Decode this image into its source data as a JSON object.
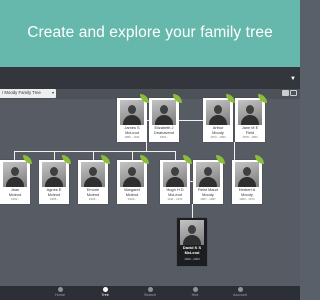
{
  "promo": {
    "title": "Create and explore your family tree"
  },
  "toolbar": {
    "tree_name": "/ Moody Family Tree"
  },
  "cards": [
    {
      "name": "James S\nMcLeod",
      "dates": "1856 - 1911"
    },
    {
      "name": "Elizabeth J\nDeahavend",
      "dates": "1864 -"
    },
    {
      "name": "Arthur\nMoody",
      "dates": "1872 - 1950"
    },
    {
      "name": "Jane M E\nField",
      "dates": "1878 - 1950"
    },
    {
      "name": "Jean\nMcleod",
      "dates": "1900 -"
    },
    {
      "name": "Agnes E\nMcleod",
      "dates": "1905 -"
    },
    {
      "name": "Emorie\nMcleod",
      "dates": "1906 -"
    },
    {
      "name": "Margaret\nMcleod",
      "dates": "1909 -"
    },
    {
      "name": "Hugh H D\nMcLeod",
      "dates": "1911 - 1971"
    },
    {
      "name": "Reist Maud\nMoody",
      "dates": "1907 - 1997"
    },
    {
      "name": "Herbert A\nMoody",
      "dates": "1906 - 1970"
    },
    {
      "name": "David K S\nMcLeod",
      "dates": "1930 - 2003"
    }
  ],
  "nav": [
    {
      "label": "Home",
      "icon": "leaf-icon"
    },
    {
      "label": "Tree",
      "icon": "tree-icon"
    },
    {
      "label": "Search",
      "icon": "search-icon"
    },
    {
      "label": "Hint",
      "icon": "hint-icon"
    },
    {
      "label": "Account",
      "icon": "account-icon"
    }
  ]
}
